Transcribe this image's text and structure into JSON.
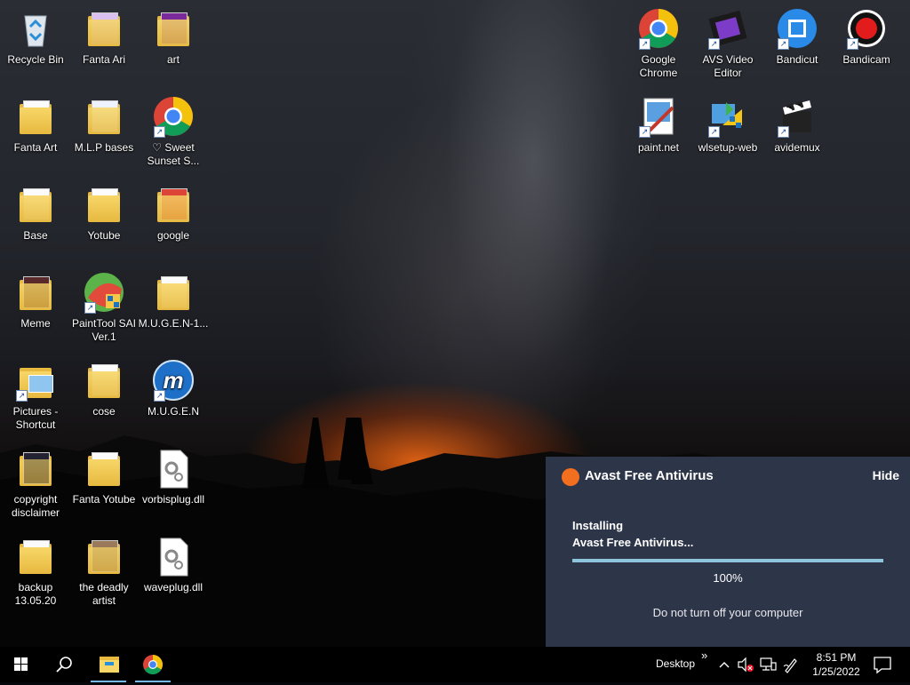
{
  "desktop": {
    "icons": [
      {
        "label": "Recycle Bin",
        "icon": "recycle-bin-icon"
      },
      {
        "label": "Fanta Ari",
        "icon": "folder-icon"
      },
      {
        "label": "art",
        "icon": "folder-icon"
      },
      {
        "label": "Fanta Art",
        "icon": "folder-icon"
      },
      {
        "label": "M.L.P bases",
        "icon": "folder-icon"
      },
      {
        "label": "♡ Sweet Sunset S...",
        "icon": "chrome-icon"
      },
      {
        "label": "Base",
        "icon": "folder-icon"
      },
      {
        "label": "Yotube",
        "icon": "folder-icon"
      },
      {
        "label": "google",
        "icon": "folder-icon"
      },
      {
        "label": "Meme",
        "icon": "folder-icon"
      },
      {
        "label": "PaintTool SAI Ver.1",
        "icon": "painttool-sai-icon"
      },
      {
        "label": "M.U.G.E.N-1...",
        "icon": "folder-icon"
      },
      {
        "label": "Pictures - Shortcut",
        "icon": "folder-icon"
      },
      {
        "label": "cose",
        "icon": "folder-icon"
      },
      {
        "label": "M.U.G.E.N",
        "icon": "mugen-icon"
      },
      {
        "label": "copyright disclaimer",
        "icon": "folder-icon"
      },
      {
        "label": "Fanta Yotube",
        "icon": "folder-icon"
      },
      {
        "label": "vorbisplug.dll",
        "icon": "dll-file-icon"
      },
      {
        "label": "backup 13.05.20",
        "icon": "folder-icon"
      },
      {
        "label": "the deadly artist",
        "icon": "folder-icon"
      },
      {
        "label": "waveplug.dll",
        "icon": "dll-file-icon"
      },
      {
        "label": "Google Chrome",
        "icon": "chrome-icon"
      },
      {
        "label": "AVS Video Editor",
        "icon": "avs-video-editor-icon"
      },
      {
        "label": "Bandicut",
        "icon": "bandicut-icon"
      },
      {
        "label": "Bandicam",
        "icon": "bandicam-icon"
      },
      {
        "label": "paint.net",
        "icon": "paintnet-icon"
      },
      {
        "label": "wlsetup-web",
        "icon": "wlsetup-icon"
      },
      {
        "label": "avidemux",
        "icon": "avidemux-icon"
      }
    ]
  },
  "avast": {
    "title": "Avast Free Antivirus",
    "hide_label": "Hide",
    "status_line1": "Installing",
    "status_line2": "Avast Free Antivirus...",
    "progress_percent": 100,
    "progress_label": "100%",
    "warning": "Do not turn off your computer",
    "colors": {
      "panel": "#2d3548",
      "accent": "#f26f20",
      "progress": "#8fc4dd"
    }
  },
  "taskbar": {
    "desktop_label": "Desktop",
    "overflow_label": "»",
    "time": "8:51 PM",
    "date": "1/25/2022",
    "pinned": [
      {
        "name": "start-button",
        "icon": "windows-icon"
      },
      {
        "name": "search-button",
        "icon": "search-icon"
      },
      {
        "name": "file-explorer-button",
        "icon": "folder-icon"
      },
      {
        "name": "chrome-button",
        "icon": "chrome-icon"
      }
    ]
  }
}
